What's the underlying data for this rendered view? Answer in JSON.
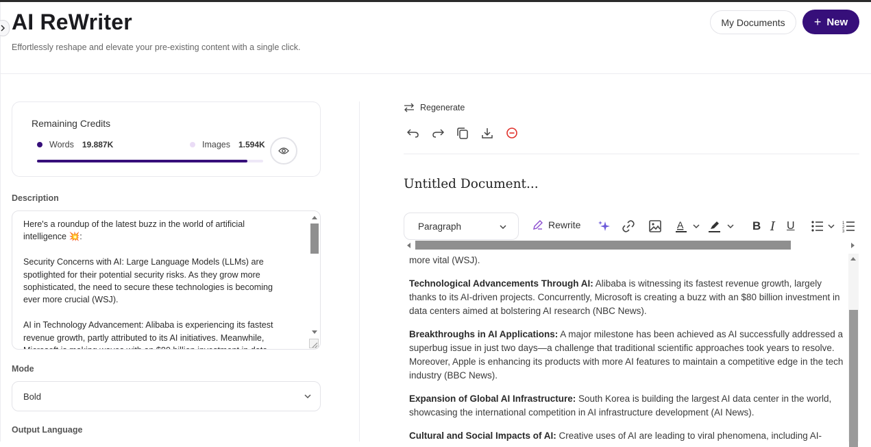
{
  "header": {
    "title": "AI ReWriter",
    "subtitle": "Effortlessly reshape and elevate your pre-existing content with a single click.",
    "my_documents_label": "My Documents",
    "new_label": "New"
  },
  "credits": {
    "title": "Remaining Credits",
    "words_label": "Words",
    "words_value": "19.887K",
    "images_label": "Images",
    "images_value": "1.594K",
    "words_fraction": 0.93,
    "words_color": "#360f7a",
    "images_color": "#eadcf6"
  },
  "description": {
    "label": "Description",
    "text": "Here's a roundup of the latest buzz in the world of artificial intelligence 💥:\n\nSecurity Concerns with AI: Large Language Models (LLMs) are spotlighted for their potential security risks. As they grow more sophisticated, the need to secure these technologies is becoming ever more crucial (WSJ).\n\nAI in Technology Advancement: Alibaba is experiencing its fastest revenue growth, partly attributed to its AI initiatives. Meanwhile, Microsoft is making waves with an $80 billion investment in data"
  },
  "mode": {
    "label": "Mode",
    "selected": "Bold"
  },
  "output_language": {
    "label": "Output Language"
  },
  "editor": {
    "regenerate_label": "Regenerate",
    "doc_title": "Untitled Document...",
    "paragraph_select": "Paragraph",
    "rewrite_label": "Rewrite",
    "partial_top": "more vital (WSJ).",
    "paragraphs": [
      {
        "heading": "Technological Advancements Through AI:",
        "body": " Alibaba is witnessing its fastest revenue growth, largely thanks to its AI-driven projects. Concurrently, Microsoft is creating a buzz with an $80 billion investment in data centers aimed at bolstering AI research (NBC News)."
      },
      {
        "heading": "Breakthroughs in AI Applications:",
        "body": " A major milestone has been achieved as AI successfully addressed a superbug issue in just two days—a challenge that traditional scientific approaches took years to resolve. Moreover, Apple is enhancing its products with more AI features to maintain a competitive edge in the tech industry (BBC News)."
      },
      {
        "heading": "Expansion of Global AI Infrastructure:",
        "body": " South Korea is building the largest AI data center in the world, showcasing the international competition in AI infrastructure development (AI News)."
      },
      {
        "heading": "Cultural and Social Impacts of AI:",
        "body": " Creative uses of AI are leading to viral phenomena, including AI-"
      }
    ]
  },
  "colors": {
    "brand": "#360f7a",
    "danger": "#e0312b",
    "sparkle": "#6b59d9",
    "rewrite_icon": "#8a4ccf"
  },
  "icons": [
    "expand-sidebar-icon",
    "plus-icon",
    "eye-icon",
    "regenerate-icon",
    "undo-icon",
    "redo-icon",
    "copy-icon",
    "download-icon",
    "delete-icon",
    "chevron-down-icon",
    "pencil-icon",
    "sparkle-icon",
    "link-icon",
    "image-icon",
    "text-color-icon",
    "highlight-icon",
    "bold-icon",
    "italic-icon",
    "underline-icon",
    "bullet-list-icon",
    "numbered-list-icon"
  ]
}
